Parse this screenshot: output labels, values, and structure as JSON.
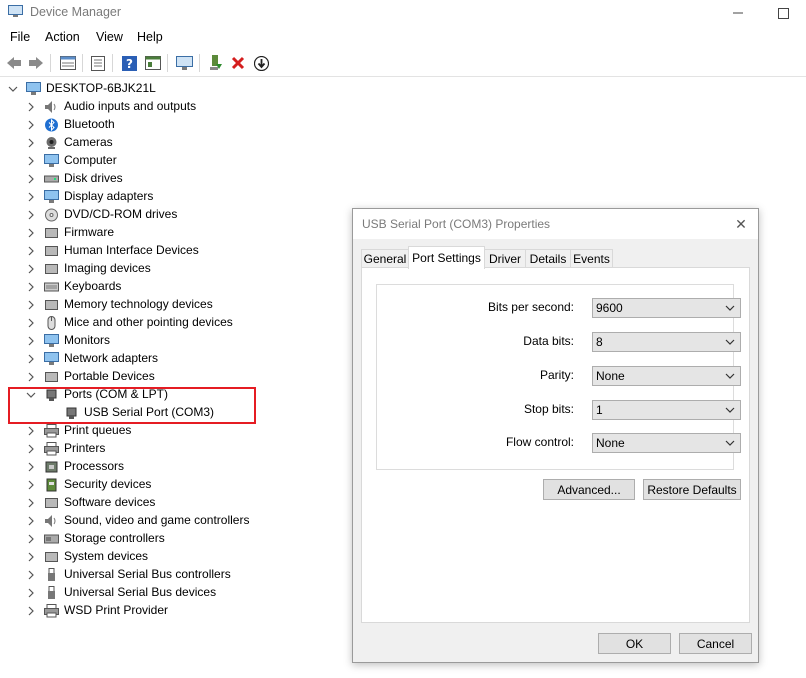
{
  "window": {
    "title": "Device Manager",
    "minimize": "—",
    "maximize": "□"
  },
  "menu": [
    "File",
    "Action",
    "View",
    "Help"
  ],
  "toolbar": [
    "back-icon",
    "forward-icon",
    "properties-grid-icon",
    "console-icon",
    "help-icon",
    "details-icon",
    "monitor-icon",
    "update-driver-icon",
    "uninstall-icon",
    "download-icon"
  ],
  "tree": {
    "root": "DESKTOP-6BJK21L",
    "categories": [
      {
        "label": "Audio inputs and outputs",
        "icon": "speaker-icon"
      },
      {
        "label": "Bluetooth",
        "icon": "bluetooth-icon"
      },
      {
        "label": "Cameras",
        "icon": "camera-icon"
      },
      {
        "label": "Computer",
        "icon": "computer-icon"
      },
      {
        "label": "Disk drives",
        "icon": "disk-drive-icon"
      },
      {
        "label": "Display adapters",
        "icon": "display-adapter-icon"
      },
      {
        "label": "DVD/CD-ROM drives",
        "icon": "dvd-icon"
      },
      {
        "label": "Firmware",
        "icon": "firmware-icon"
      },
      {
        "label": "Human Interface Devices",
        "icon": "hid-icon"
      },
      {
        "label": "Imaging devices",
        "icon": "imaging-icon"
      },
      {
        "label": "Keyboards",
        "icon": "keyboard-icon"
      },
      {
        "label": "Memory technology devices",
        "icon": "memory-icon"
      },
      {
        "label": "Mice and other pointing devices",
        "icon": "mouse-icon"
      },
      {
        "label": "Monitors",
        "icon": "monitor-icon"
      },
      {
        "label": "Network adapters",
        "icon": "network-icon"
      },
      {
        "label": "Portable Devices",
        "icon": "portable-device-icon"
      },
      {
        "label": "Ports (COM & LPT)",
        "icon": "port-icon"
      },
      {
        "label": "Print queues",
        "icon": "print-queue-icon"
      },
      {
        "label": "Printers",
        "icon": "printer-icon"
      },
      {
        "label": "Processors",
        "icon": "processor-icon"
      },
      {
        "label": "Security devices",
        "icon": "security-icon"
      },
      {
        "label": "Software devices",
        "icon": "software-icon"
      },
      {
        "label": "Sound, video and game controllers",
        "icon": "sound-icon"
      },
      {
        "label": "Storage controllers",
        "icon": "storage-icon"
      },
      {
        "label": "System devices",
        "icon": "system-icon"
      },
      {
        "label": "Universal Serial Bus controllers",
        "icon": "usb-icon"
      },
      {
        "label": "Universal Serial Bus devices",
        "icon": "usb-icon"
      },
      {
        "label": "WSD Print Provider",
        "icon": "printer-icon"
      }
    ],
    "child": {
      "label": "USB Serial Port (COM3)",
      "icon": "port-icon"
    }
  },
  "dialog": {
    "title": "USB Serial Port (COM3) Properties",
    "close": "✕",
    "tabs": [
      "General",
      "Port Settings",
      "Driver",
      "Details",
      "Events"
    ],
    "active_tab": "Port Settings",
    "fields": [
      {
        "label": "Bits per second:",
        "value": "9600"
      },
      {
        "label": "Data bits:",
        "value": "8"
      },
      {
        "label": "Parity:",
        "value": "None"
      },
      {
        "label": "Stop bits:",
        "value": "1"
      },
      {
        "label": "Flow control:",
        "value": "None"
      }
    ],
    "advanced_label": "Advanced...",
    "restore_label": "Restore Defaults",
    "ok_label": "OK",
    "cancel_label": "Cancel"
  },
  "colors": {
    "highlight": "#e51c23",
    "accent": "#0078d7"
  }
}
